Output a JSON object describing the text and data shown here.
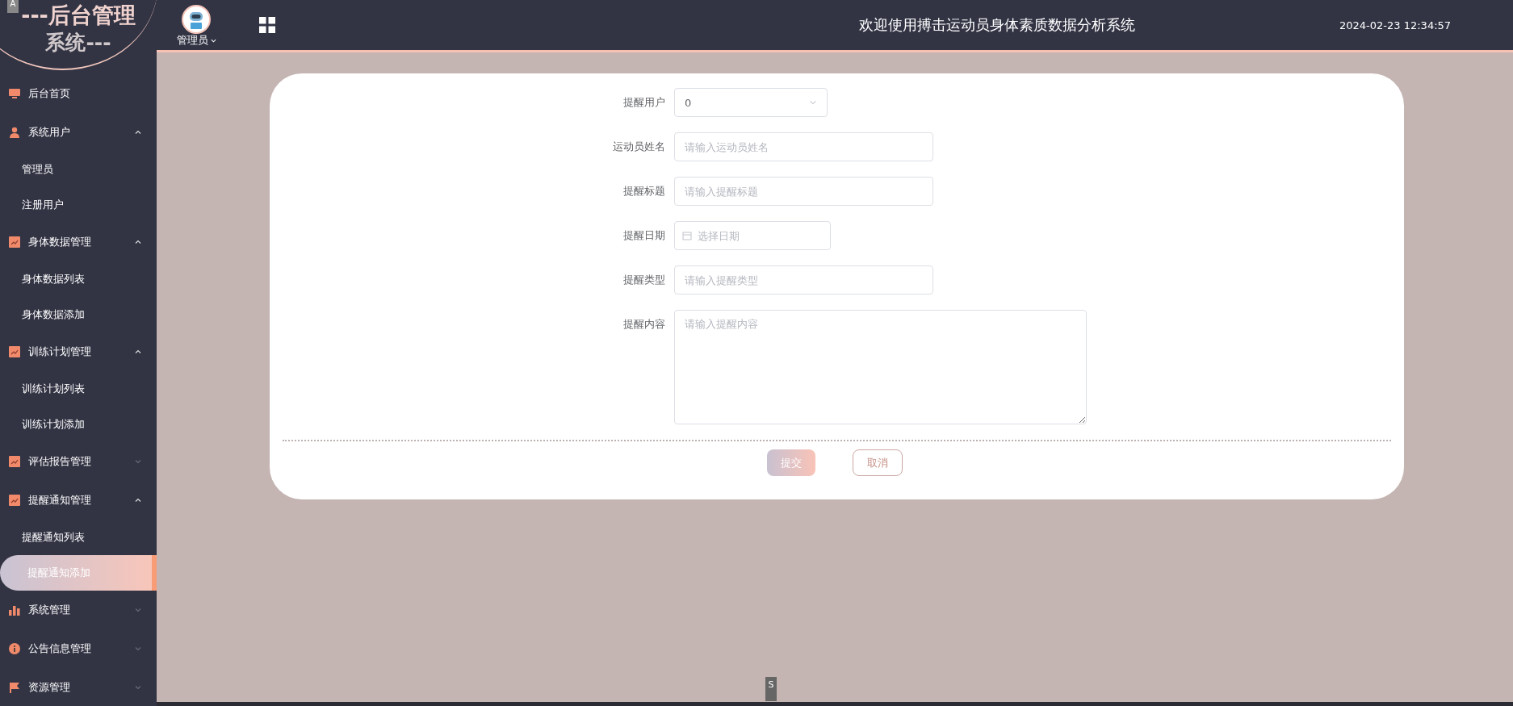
{
  "logo": {
    "lines": [
      "---后台管理",
      "系统---"
    ]
  },
  "corner_tabs": [
    "A",
    "S"
  ],
  "header": {
    "user": "管理员",
    "title": "欢迎使用搏击运动员身体素质数据分析系统",
    "time": "2024-02-23 12:34:57"
  },
  "sidebar": {
    "items": [
      {
        "label": "后台首页",
        "kind": "monitor"
      },
      {
        "label": "系统用户",
        "kind": "person",
        "expanded": true,
        "children": [
          {
            "label": "管理员",
            "selected": false
          },
          {
            "label": "注册用户",
            "selected": false
          }
        ]
      },
      {
        "label": "身体数据管理",
        "kind": "chart",
        "expanded": true,
        "children": [
          {
            "label": "身体数据列表",
            "selected": false
          },
          {
            "label": "身体数据添加",
            "selected": false
          }
        ]
      },
      {
        "label": "训练计划管理",
        "kind": "chart",
        "expanded": true,
        "children": [
          {
            "label": "训练计划列表",
            "selected": false
          },
          {
            "label": "训练计划添加",
            "selected": false
          }
        ]
      },
      {
        "label": "评估报告管理",
        "kind": "chart",
        "expanded": false
      },
      {
        "label": "提醒通知管理",
        "kind": "chart",
        "expanded": true,
        "children": [
          {
            "label": "提醒通知列表",
            "selected": false
          },
          {
            "label": "提醒通知添加",
            "selected": true
          }
        ]
      },
      {
        "label": "系统管理",
        "kind": "bars",
        "expanded": false
      },
      {
        "label": "公告信息管理",
        "kind": "info",
        "expanded": false
      },
      {
        "label": "资源管理",
        "kind": "flag",
        "expanded": false
      }
    ]
  },
  "form": {
    "fields": [
      {
        "kind": "select",
        "label": "提醒用户",
        "value": "0"
      },
      {
        "kind": "input",
        "label": "运动员姓名",
        "placeholder": "请输入运动员姓名"
      },
      {
        "kind": "input",
        "label": "提醒标题",
        "placeholder": "请输入提醒标题"
      },
      {
        "kind": "date",
        "label": "提醒日期",
        "placeholder": "选择日期"
      },
      {
        "kind": "input",
        "label": "提醒类型",
        "placeholder": "请输入提醒类型"
      },
      {
        "kind": "textarea",
        "label": "提醒内容",
        "placeholder": "请输入提醒内容"
      }
    ],
    "buttons": [
      {
        "kind": "primary",
        "label": "提交"
      },
      {
        "kind": "plain",
        "label": "取消"
      }
    ]
  }
}
